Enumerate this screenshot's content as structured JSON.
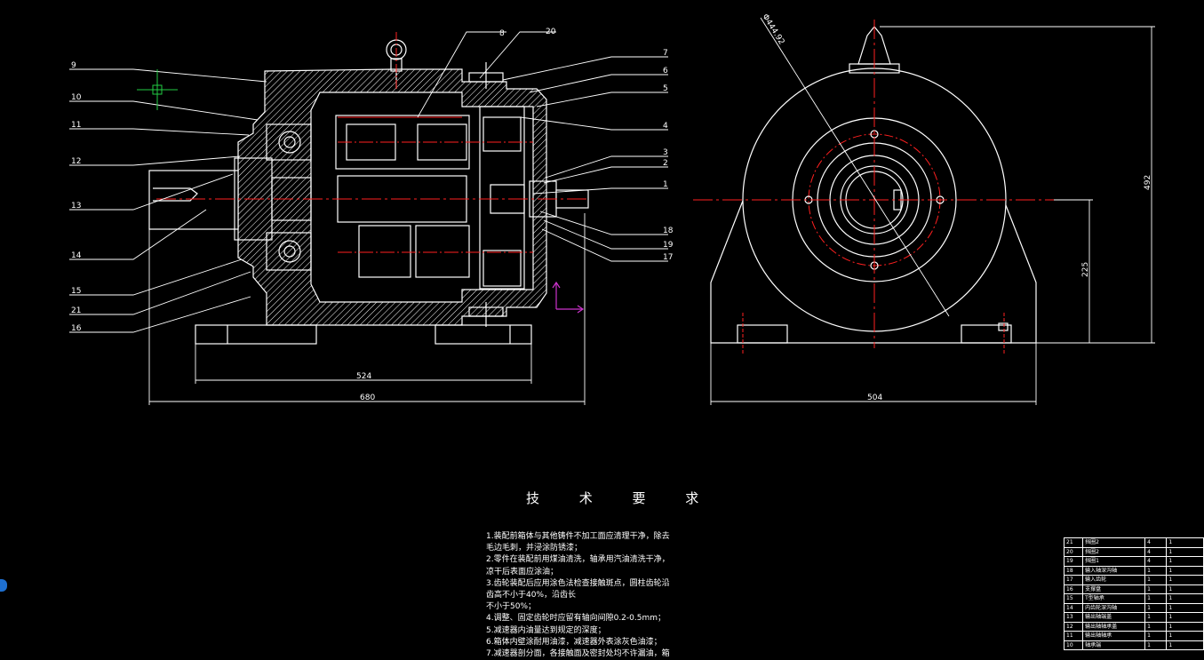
{
  "leader_labels": [
    "9",
    "10",
    "11",
    "12",
    "13",
    "14",
    "15",
    "21",
    "16",
    "8",
    "20",
    "7",
    "6",
    "5",
    "4",
    "3",
    "2",
    "1",
    "18",
    "19",
    "17"
  ],
  "dimensions": {
    "base_width": "524",
    "overall_width": "680",
    "side_width": "504",
    "overall_height": "492",
    "shaft_height": "225",
    "diameter_label": "Φ444.92"
  },
  "tech_requirements": {
    "title": "技 术 要 求",
    "lines": [
      "1.装配前箱体与其他铸件不加工面应清理干净，除去",
      "毛边毛刺，并浸涂防锈漆；",
      "2.零件在装配前用煤油清洗，轴承用汽油清洗干净，",
      "凉干后表面应涂油；",
      "3.齿轮装配后应用涂色法检查接触斑点，圆柱齿轮沿",
      "齿高不小于40%，沿齿长",
      "   不小于50%；",
      "4.调整、固定齿轮时应留有轴向间隙0.2-0.5mm；",
      "5.减速器内油量达到规定的深度；",
      "6.箱体内壁涂耐用油漆，减速器外表涂灰色油漆；",
      "7.减速器剖分面，各接触面及密封处均不许漏油，箱"
    ]
  },
  "bom": [
    [
      "21",
      "挡圈2",
      "4",
      "1"
    ],
    [
      "20",
      "挡圈2",
      "4",
      "1"
    ],
    [
      "19",
      "挡圈1",
      "4",
      "1"
    ],
    [
      "18",
      "输入轴深沟轴",
      "1",
      "1"
    ],
    [
      "17",
      "输入齿轮",
      "1",
      "1"
    ],
    [
      "16",
      "支撑盘",
      "1",
      "1"
    ],
    [
      "15",
      "T型轴承",
      "1",
      "1"
    ],
    [
      "14",
      "内齿轮深沟轴",
      "1",
      "1"
    ],
    [
      "13",
      "输出轴端盖",
      "1",
      "1"
    ],
    [
      "12",
      "输出轴轴承盖",
      "1",
      "1"
    ],
    [
      "11",
      "输出轴轴承",
      "1",
      "1"
    ],
    [
      "10",
      "轴承端",
      "1",
      "1"
    ]
  ],
  "colors": {
    "line": "#ffffff",
    "center": "#ff2020",
    "axis": "#cc33cc",
    "marker": "#22cc44",
    "icon": "#1e6fd0"
  }
}
